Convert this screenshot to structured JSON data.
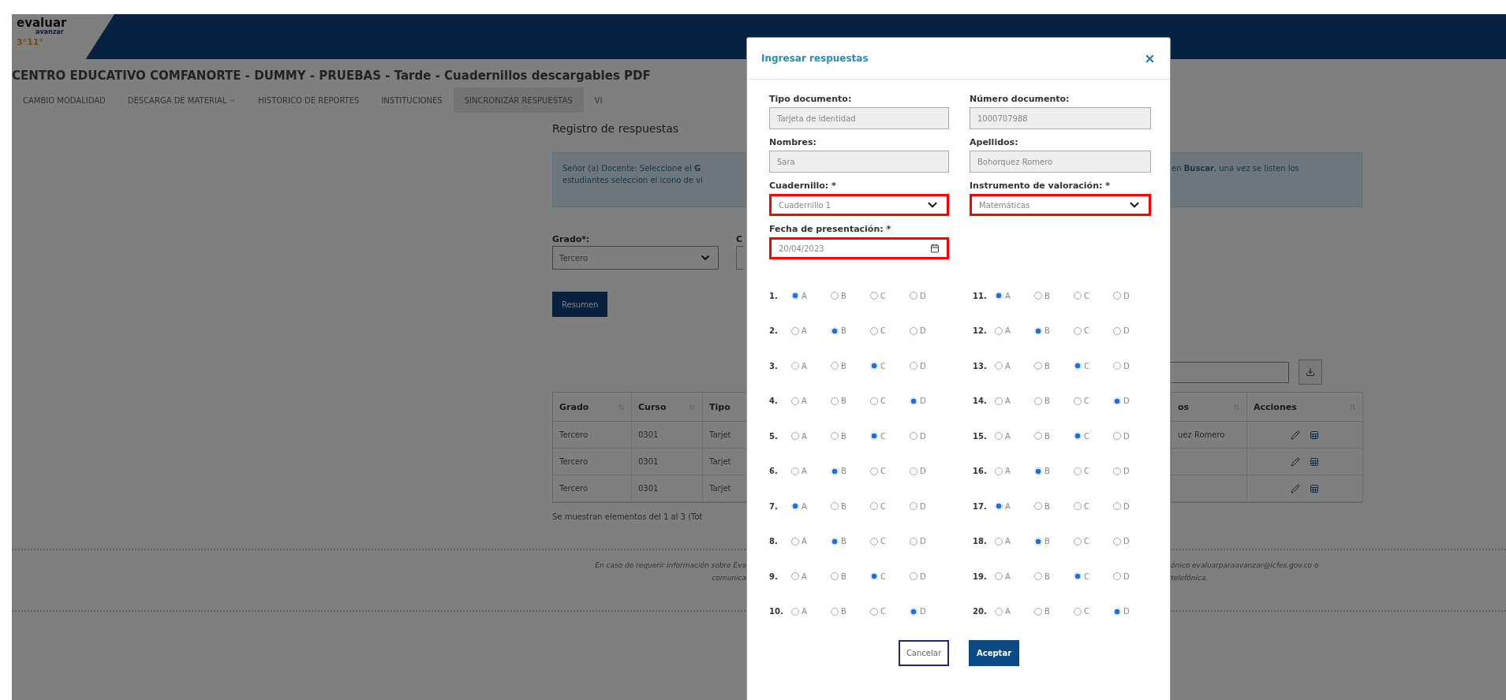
{
  "logo": {
    "line1": "evaluar",
    "line2": "avanzar",
    "line3": "3°11°"
  },
  "page_title": "CENTRO EDUCATIVO COMFANORTE - DUMMY - PRUEBAS - Tarde - Cuadernillos descargables PDF",
  "nav": [
    {
      "label": "CAMBIO MODALIDAD",
      "selected": false,
      "dropdown": false
    },
    {
      "label": "DESCARGA DE MATERIAL",
      "selected": false,
      "dropdown": true
    },
    {
      "label": "HISTORICO DE REPORTES",
      "selected": false,
      "dropdown": false
    },
    {
      "label": "INSTITUCIONES",
      "selected": false,
      "dropdown": false
    },
    {
      "label": "SINCRONIZAR RESPUESTAS",
      "selected": true,
      "dropdown": false
    },
    {
      "label": "VI",
      "selected": false,
      "dropdown": false
    }
  ],
  "section_title": "Registro de respuestas",
  "alert": {
    "lines": [
      "Señor (a) Docente: Seleccione el **G**",
      "estudiantes seleccion el icono de vi"
    ],
    "tail": "en **Buscar**, una vez se listen los"
  },
  "grado": {
    "label": "Grado*:",
    "value": "Tercero"
  },
  "next_label": "C",
  "summary_button": "Resumen",
  "table": {
    "columns": [
      "Grado",
      "Curso",
      "Tipo",
      "os",
      "Acciones"
    ],
    "rows": [
      {
        "cells": [
          "Tercero",
          "0301",
          "Tarjet",
          "uez Romero"
        ]
      },
      {
        "cells": [
          "Tercero",
          "0301",
          "Tarjet"
        ]
      },
      {
        "cells": [
          "Tercero",
          "0301",
          "Tarjet"
        ]
      }
    ]
  },
  "table_info": "Se muestran elementos del 1 al 3 (Tot",
  "footer": {
    "left_lines": [
      "En caso de requerir información sobre Eva",
      "comunica"
    ],
    "right_lines": [
      "ónico evaluarparaavanzar@icfes.gov.co o",
      "telefónica."
    ]
  },
  "modal": {
    "title": "Ingresar respuestas",
    "fields": [
      {
        "label": "Tipo documento:",
        "value": "Tarjeta de identidad",
        "kind": "text",
        "highlighted": false
      },
      {
        "label": "Número documento:",
        "value": "1000707988",
        "kind": "text",
        "highlighted": false
      },
      {
        "label": "Nombres:",
        "value": "Sara",
        "kind": "text",
        "highlighted": false
      },
      {
        "label": "Apellidos:",
        "value": "Bohorquez Romero",
        "kind": "text",
        "highlighted": false
      },
      {
        "label": "Cuadernillo: *",
        "value": "Cuadernillo 1",
        "kind": "select",
        "highlighted": true
      },
      {
        "label": "Instrumento de valoración: *",
        "value": "Matemáticas",
        "kind": "select",
        "highlighted": true
      },
      {
        "label": "Fecha de presentación: *",
        "value": "20/04/2023",
        "kind": "date",
        "highlighted": true
      }
    ],
    "questions": [
      {
        "number": "1.",
        "options": [
          {
            "label": "A",
            "selected": true
          },
          {
            "label": "B",
            "selected": false
          },
          {
            "label": "C",
            "selected": false
          },
          {
            "label": "D",
            "selected": false
          }
        ]
      },
      {
        "number": "2.",
        "options": [
          {
            "label": "A",
            "selected": false
          },
          {
            "label": "B",
            "selected": true
          },
          {
            "label": "C",
            "selected": false
          },
          {
            "label": "D",
            "selected": false
          }
        ]
      },
      {
        "number": "3.",
        "options": [
          {
            "label": "A",
            "selected": false
          },
          {
            "label": "B",
            "selected": false
          },
          {
            "label": "C",
            "selected": true
          },
          {
            "label": "D",
            "selected": false
          }
        ]
      },
      {
        "number": "4.",
        "options": [
          {
            "label": "A",
            "selected": false
          },
          {
            "label": "B",
            "selected": false
          },
          {
            "label": "C",
            "selected": false
          },
          {
            "label": "D",
            "selected": true
          }
        ]
      },
      {
        "number": "5.",
        "options": [
          {
            "label": "A",
            "selected": false
          },
          {
            "label": "B",
            "selected": false
          },
          {
            "label": "C",
            "selected": true
          },
          {
            "label": "D",
            "selected": false
          }
        ]
      },
      {
        "number": "6.",
        "options": [
          {
            "label": "A",
            "selected": false
          },
          {
            "label": "B",
            "selected": true
          },
          {
            "label": "C",
            "selected": false
          },
          {
            "label": "D",
            "selected": false
          }
        ]
      },
      {
        "number": "7.",
        "options": [
          {
            "label": "A",
            "selected": true
          },
          {
            "label": "B",
            "selected": false
          },
          {
            "label": "C",
            "selected": false
          },
          {
            "label": "D",
            "selected": false
          }
        ]
      },
      {
        "number": "8.",
        "options": [
          {
            "label": "A",
            "selected": false
          },
          {
            "label": "B",
            "selected": true
          },
          {
            "label": "C",
            "selected": false
          },
          {
            "label": "D",
            "selected": false
          }
        ]
      },
      {
        "number": "9.",
        "options": [
          {
            "label": "A",
            "selected": false
          },
          {
            "label": "B",
            "selected": false
          },
          {
            "label": "C",
            "selected": true
          },
          {
            "label": "D",
            "selected": false
          }
        ]
      },
      {
        "number": "10.",
        "options": [
          {
            "label": "A",
            "selected": false
          },
          {
            "label": "B",
            "selected": false
          },
          {
            "label": "C",
            "selected": false
          },
          {
            "label": "D",
            "selected": true
          }
        ]
      },
      {
        "number": "11.",
        "options": [
          {
            "label": "A",
            "selected": true
          },
          {
            "label": "B",
            "selected": false
          },
          {
            "label": "C",
            "selected": false
          },
          {
            "label": "D",
            "selected": false
          }
        ]
      },
      {
        "number": "12.",
        "options": [
          {
            "label": "A",
            "selected": false
          },
          {
            "label": "B",
            "selected": true
          },
          {
            "label": "C",
            "selected": false
          },
          {
            "label": "D",
            "selected": false
          }
        ]
      },
      {
        "number": "13.",
        "options": [
          {
            "label": "A",
            "selected": false
          },
          {
            "label": "B",
            "selected": false
          },
          {
            "label": "C",
            "selected": true
          },
          {
            "label": "D",
            "selected": false
          }
        ]
      },
      {
        "number": "14.",
        "options": [
          {
            "label": "A",
            "selected": false
          },
          {
            "label": "B",
            "selected": false
          },
          {
            "label": "C",
            "selected": false
          },
          {
            "label": "D",
            "selected": true
          }
        ]
      },
      {
        "number": "15.",
        "options": [
          {
            "label": "A",
            "selected": false
          },
          {
            "label": "B",
            "selected": false
          },
          {
            "label": "C",
            "selected": true
          },
          {
            "label": "D",
            "selected": false
          }
        ]
      },
      {
        "number": "16.",
        "options": [
          {
            "label": "A",
            "selected": false
          },
          {
            "label": "B",
            "selected": true
          },
          {
            "label": "C",
            "selected": false
          },
          {
            "label": "D",
            "selected": false
          }
        ]
      },
      {
        "number": "17.",
        "options": [
          {
            "label": "A",
            "selected": true
          },
          {
            "label": "B",
            "selected": false
          },
          {
            "label": "C",
            "selected": false
          },
          {
            "label": "D",
            "selected": false
          }
        ]
      },
      {
        "number": "18.",
        "options": [
          {
            "label": "A",
            "selected": false
          },
          {
            "label": "B",
            "selected": true
          },
          {
            "label": "C",
            "selected": false
          },
          {
            "label": "D",
            "selected": false
          }
        ]
      },
      {
        "number": "19.",
        "options": [
          {
            "label": "A",
            "selected": false
          },
          {
            "label": "B",
            "selected": false
          },
          {
            "label": "C",
            "selected": true
          },
          {
            "label": "D",
            "selected": false
          }
        ]
      },
      {
        "number": "20.",
        "options": [
          {
            "label": "A",
            "selected": false
          },
          {
            "label": "B",
            "selected": false
          },
          {
            "label": "C",
            "selected": false
          },
          {
            "label": "D",
            "selected": true
          }
        ]
      }
    ],
    "cancel_button": "Cancelar",
    "accept_button": "Aceptar"
  }
}
